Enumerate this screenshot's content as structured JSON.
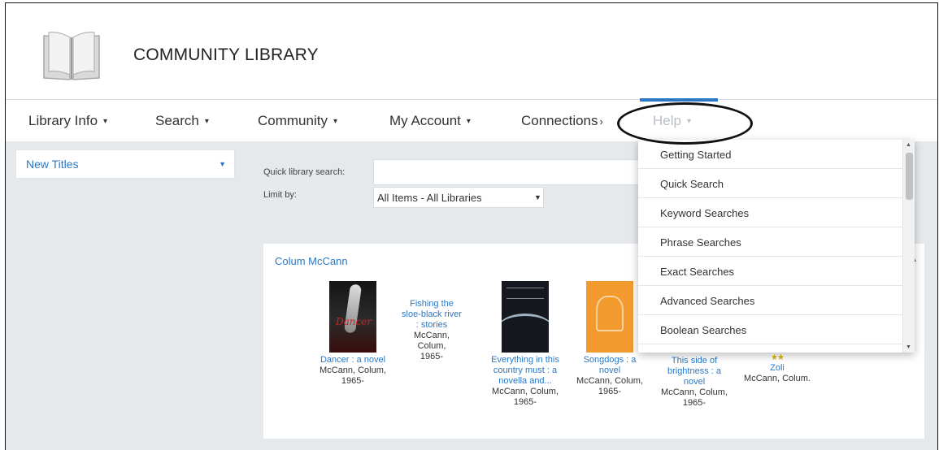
{
  "site": {
    "title": "COMMUNITY LIBRARY"
  },
  "nav": {
    "items": [
      {
        "label": "Library Info",
        "caret": "▾"
      },
      {
        "label": "Search",
        "caret": "▾"
      },
      {
        "label": "Community",
        "caret": "▾"
      },
      {
        "label": "My Account",
        "caret": "▾"
      },
      {
        "label": "Connections",
        "caret": "›"
      },
      {
        "label": "Help",
        "caret": "▾"
      }
    ]
  },
  "sidebar": {
    "selected": "New Titles"
  },
  "quick_search": {
    "label": "Quick library search:",
    "value": "",
    "limit_label": "Limit by:",
    "limit_value": "All Items - All Libraries"
  },
  "panel": {
    "title": "Colum McCann",
    "books": [
      {
        "title": "Dancer : a novel",
        "author": "McCann, Colum,",
        "year": "1965-"
      },
      {
        "title": "Fishing the sloe-black river : stories",
        "author": "McCann, Colum,",
        "year": "1965-"
      },
      {
        "title": "Everything in this country must : a novella and...",
        "author": "McCann, Colum,",
        "year": "1965-"
      },
      {
        "title": "Songdogs : a novel",
        "author": "McCann, Colum,",
        "year": "1965-"
      },
      {
        "title": "This side of brightness : a novel",
        "author": "McCann, Colum,",
        "year": "1965-"
      },
      {
        "title": "Zoli",
        "author": "McCann, Colum.",
        "year": "",
        "stars": "★★"
      }
    ]
  },
  "help_menu": {
    "items": [
      "Getting Started",
      "Quick Search",
      "Keyword Searches",
      "Phrase Searches",
      "Exact Searches",
      "Advanced Searches",
      "Boolean Searches"
    ]
  },
  "colors": {
    "accent": "#2a78c4",
    "background": "#e6e9ec",
    "muted_nav": "#b9bfc5"
  },
  "icons": {
    "logo": "open-book-icon",
    "scroll_up": "▲",
    "scroll_down": "▼",
    "collapse": "▲"
  }
}
